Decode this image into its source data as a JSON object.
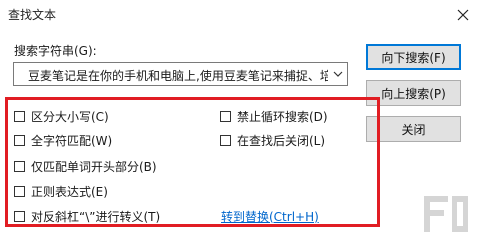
{
  "window": {
    "title": "查找文本"
  },
  "search": {
    "label": "搜索字符串(G):",
    "value": "豆麦笔记是在你的手机和电脑上,使用豆麦笔记来捕捉、培"
  },
  "buttons": {
    "find_next": "向下搜索(F)",
    "find_prev": "向上搜索(P)",
    "close": "关闭"
  },
  "options": {
    "match_case": "区分大小写(C)",
    "whole_char": "全字符匹配(W)",
    "word_start": "仅匹配单词开头部分(B)",
    "regex": "正则表达式(E)",
    "escape": "对反斜杠“\\”进行转义(T)",
    "no_wrap": "禁止循环搜索(D)",
    "close_after": "在查找后关闭(L)"
  },
  "link": {
    "replace": "转到替换(Ctrl+H)"
  },
  "colors": {
    "highlight": "#e11d23",
    "link": "#0066cc",
    "accent": "#0078d7"
  },
  "icons": {
    "close": "close-icon",
    "dropdown": "chevron-down-icon",
    "watermark": "logo-watermark"
  }
}
